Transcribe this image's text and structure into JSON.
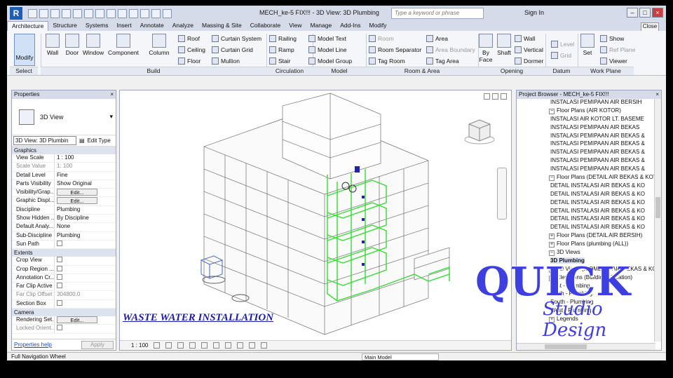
{
  "app": {
    "logo": "R",
    "title": "MECH_ke-5 FIX!!! - 3D View: 3D Plumbing",
    "search_placeholder": "Type a keyword or phrase",
    "sign_in": "Sign In"
  },
  "tabs": [
    "Architecture",
    "Structure",
    "Systems",
    "Insert",
    "Annotate",
    "Analyze",
    "Massing & Site",
    "Collaborate",
    "View",
    "Manage",
    "Add-Ins",
    "Modify"
  ],
  "close_label": "Close",
  "ribbon": {
    "modify": "Modify",
    "select": "Select",
    "build_big": [
      "Wall",
      "Door",
      "Window",
      "Component",
      "Column"
    ],
    "build_small_a": [
      "Roof",
      "Ceiling",
      "Floor"
    ],
    "build_small_b": [
      "Curtain System",
      "Curtain Grid",
      "Mullion"
    ],
    "circulation": [
      "Railing",
      "Ramp",
      "Stair"
    ],
    "model": [
      "Model Text",
      "Model Line",
      "Model Group"
    ],
    "room_a": [
      "Room",
      "Room Separator",
      "Tag Room"
    ],
    "room_b": [
      "Area",
      "Area Boundary",
      "Tag Area"
    ],
    "opening_big": [
      "By Face",
      "Shaft"
    ],
    "opening_small": [
      "Wall",
      "Vertical",
      "Dormer"
    ],
    "datum": [
      "Level",
      "Grid"
    ],
    "workplane_big": "Set",
    "workplane_small": [
      "Show",
      "Ref Plane",
      "Viewer"
    ],
    "groups": [
      "Build",
      "Circulation",
      "Model",
      "Room & Area",
      "Opening",
      "Datum",
      "Work Plane"
    ]
  },
  "properties": {
    "title": "Properties",
    "type_name": "3D View",
    "view_select": "3D View: 3D Plumbin",
    "edit_type": "Edit Type",
    "sections": {
      "graphics": "Graphics",
      "extents": "Extents",
      "camera": "Camera"
    },
    "graphics_rows": [
      {
        "k": "View Scale",
        "v": "1 : 100"
      },
      {
        "k": "Scale Value",
        "v": "1:  100"
      },
      {
        "k": "Detail Level",
        "v": "Fine"
      },
      {
        "k": "Parts Visibility",
        "v": "Show Original"
      },
      {
        "k": "Visibility/Grap...",
        "v": "Edit..."
      },
      {
        "k": "Graphic Displ...",
        "v": "Edit..."
      },
      {
        "k": "Discipline",
        "v": "Plumbing"
      },
      {
        "k": "Show Hidden ...",
        "v": "By Discipline"
      },
      {
        "k": "Default Analy...",
        "v": "None"
      },
      {
        "k": "Sub-Discipline",
        "v": "Plumbing"
      },
      {
        "k": "Sun Path",
        "v": ""
      }
    ],
    "extents_rows": [
      {
        "k": "Crop View",
        "v": ""
      },
      {
        "k": "Crop Region ...",
        "v": ""
      },
      {
        "k": "Annotation Cr...",
        "v": ""
      },
      {
        "k": "Far Clip Active",
        "v": ""
      },
      {
        "k": "Far Clip Offset",
        "v": "304800.0"
      },
      {
        "k": "Section Box",
        "v": ""
      }
    ],
    "camera_rows": [
      {
        "k": "Rendering Set...",
        "v": "Edit..."
      },
      {
        "k": "Locked Orient...",
        "v": ""
      }
    ],
    "help": "Properties help",
    "apply": "Apply"
  },
  "viewport": {
    "caption": "WASTE WATER INSTALLATION",
    "scale": "1 : 100"
  },
  "browser": {
    "title": "Project Browser - MECH_ke-5 FIX!!!",
    "nodes": [
      {
        "t": "INSTALASI PEMIPAAN AIR BERSIH",
        "lvl": 1
      },
      {
        "t": "Floor Plans (AIR KOTOR)",
        "lvl": 0,
        "pm": "−"
      },
      {
        "t": "INSTALASI AIR KOTOR LT. BASEME",
        "lvl": 1
      },
      {
        "t": "INSTALASI PEMIPAAN  AIR BEKAS",
        "lvl": 1
      },
      {
        "t": "INSTALASI PEMIPAAN AIR BEKAS &",
        "lvl": 1
      },
      {
        "t": "INSTALASI PEMIPAAN AIR BEKAS &",
        "lvl": 1
      },
      {
        "t": "INSTALASI PEMIPAAN AIR BEKAS &",
        "lvl": 1
      },
      {
        "t": "INSTALASI PEMIPAAN AIR BEKAS &",
        "lvl": 1
      },
      {
        "t": "INSTALASI PEMIPAAN AIR BEKAS &",
        "lvl": 1
      },
      {
        "t": "Floor Plans (DETAIL AIR BEKAS & KOT",
        "lvl": 0,
        "pm": "−"
      },
      {
        "t": "DETAIL INSTALASI AIR BEKAS & KO",
        "lvl": 1
      },
      {
        "t": "DETAIL INSTALASI AIR BEKAS & KO",
        "lvl": 1
      },
      {
        "t": "DETAIL INSTALASI AIR BEKAS & KO",
        "lvl": 1
      },
      {
        "t": "DETAIL INSTALASI AIR BEKAS & KO",
        "lvl": 1
      },
      {
        "t": "DETAIL INSTALASI AIR BEKAS & KO",
        "lvl": 1
      },
      {
        "t": "DETAIL INSTALASI AIR BEKAS & KO",
        "lvl": 1
      },
      {
        "t": "Floor Plans (DETAIL AIR BERSIH)",
        "lvl": 0,
        "pm": "+"
      },
      {
        "t": "Floor Plans (plumbing (ALL))",
        "lvl": 0,
        "pm": "+"
      },
      {
        "t": "3D Views",
        "lvl": 0,
        "pm": "−"
      },
      {
        "t": "3D Plumbing",
        "lvl": 1,
        "sel": true
      },
      {
        "t": "3D Views (ISOMETRI AIR BEKAS & KOT",
        "lvl": 0,
        "pm": "+"
      },
      {
        "t": "Elevations (Building Elevation)",
        "lvl": 0,
        "pm": "−"
      },
      {
        "t": "East - Plumbing",
        "lvl": 1
      },
      {
        "t": "North - Plumbing",
        "lvl": 1
      },
      {
        "t": "South - Plumbing",
        "lvl": 1
      },
      {
        "t": "West - Plumbing",
        "lvl": 1
      },
      {
        "t": "Legends",
        "lvl": 0,
        "pm": "+"
      }
    ]
  },
  "watermark": {
    "line1": "QUICK",
    "line2": "Studio Design"
  },
  "status": {
    "text": "Full Navigation Wheel",
    "model": "Main Model"
  },
  "colors": {
    "pipe": "#33dd33",
    "caption": "#1b1bb0",
    "watermark": "#3e3fe0"
  }
}
